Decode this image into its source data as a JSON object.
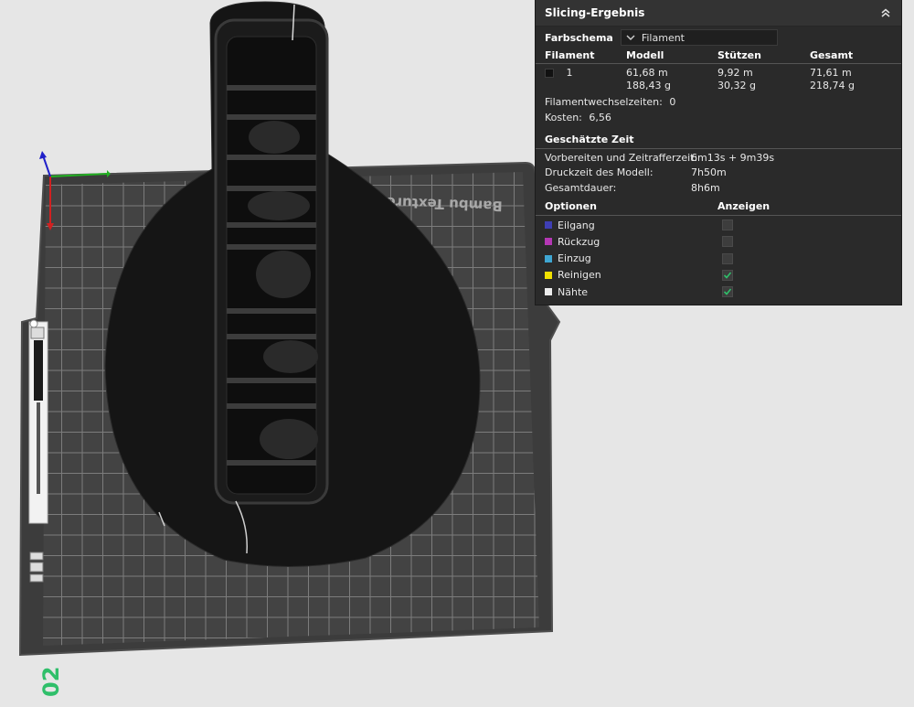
{
  "bed": {
    "texture_label": "Bambu Texture",
    "plate_number": "02"
  },
  "slicing_panel": {
    "title": "Slicing-Ergebnis",
    "color_scheme": {
      "label": "Farbschema",
      "value": "Filament"
    },
    "table": {
      "headers": {
        "filament": "Filament",
        "model": "Modell",
        "supports": "Stützen",
        "total": "Gesamt"
      },
      "rows": [
        {
          "filament": "1",
          "model_length": "61,68 m",
          "model_weight": "188,43 g",
          "supports_length": "9,92 m",
          "supports_weight": "30,32 g",
          "total_length": "71,61 m",
          "total_weight": "218,74 g"
        }
      ]
    },
    "filament_change": {
      "label": "Filamentwechselzeiten:",
      "value": "0"
    },
    "cost": {
      "label": "Kosten:",
      "value": "6,56"
    },
    "estimated_time": {
      "title": "Geschätzte Zeit",
      "prep": {
        "label": "Vorbereiten und Zeitrafferzeit:",
        "value": "6m13s + 9m39s"
      },
      "model": {
        "label": "Druckzeit des Modell:",
        "value": "7h50m"
      },
      "total": {
        "label": "Gesamtdauer:",
        "value": "8h6m"
      }
    },
    "options": {
      "title": "Optionen",
      "show_title": "Anzeigen",
      "items": [
        {
          "label": "Eilgang",
          "color": "#3f3fb4",
          "checked": false
        },
        {
          "label": "Rückzug",
          "color": "#b437b4",
          "checked": false
        },
        {
          "label": "Einzug",
          "color": "#3fa6d2",
          "checked": false
        },
        {
          "label": "Reinigen",
          "color": "#f0e000",
          "checked": true
        },
        {
          "label": "Nähte",
          "color": "#ececec",
          "checked": true
        }
      ]
    }
  },
  "colors": {
    "accent_green": "#2fbf6a",
    "panel_bg": "#2a2a2a",
    "check_green": "#2fbf6a"
  }
}
